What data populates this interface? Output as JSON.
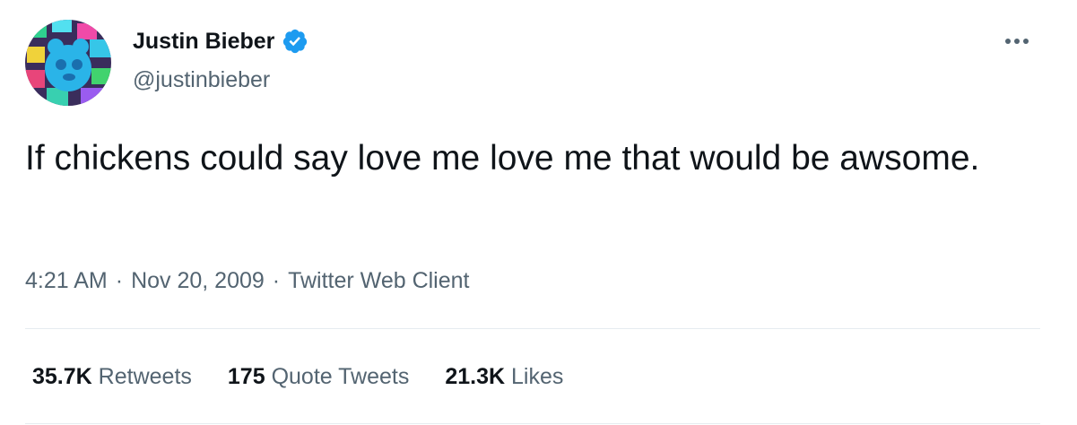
{
  "author": {
    "display_name": "Justin Bieber",
    "handle": "@justinbieber",
    "verified": true,
    "avatar_icon": "avatar-image",
    "verified_icon": "verified-badge-icon",
    "verified_color": "#1d9bf0"
  },
  "tweet": {
    "text": "If chickens could say love me love me that would be awsome."
  },
  "meta": {
    "time": "4:21 AM",
    "separator": "·",
    "date": "Nov 20, 2009",
    "source": "Twitter Web Client"
  },
  "stats": [
    {
      "count": "35.7K",
      "label": "Retweets"
    },
    {
      "count": "175",
      "label": "Quote Tweets"
    },
    {
      "count": "21.3K",
      "label": "Likes"
    }
  ],
  "colors": {
    "text_primary": "#0f1419",
    "text_secondary": "#536471",
    "divider": "#e6ecf0"
  },
  "more_icon": "more-options-icon"
}
